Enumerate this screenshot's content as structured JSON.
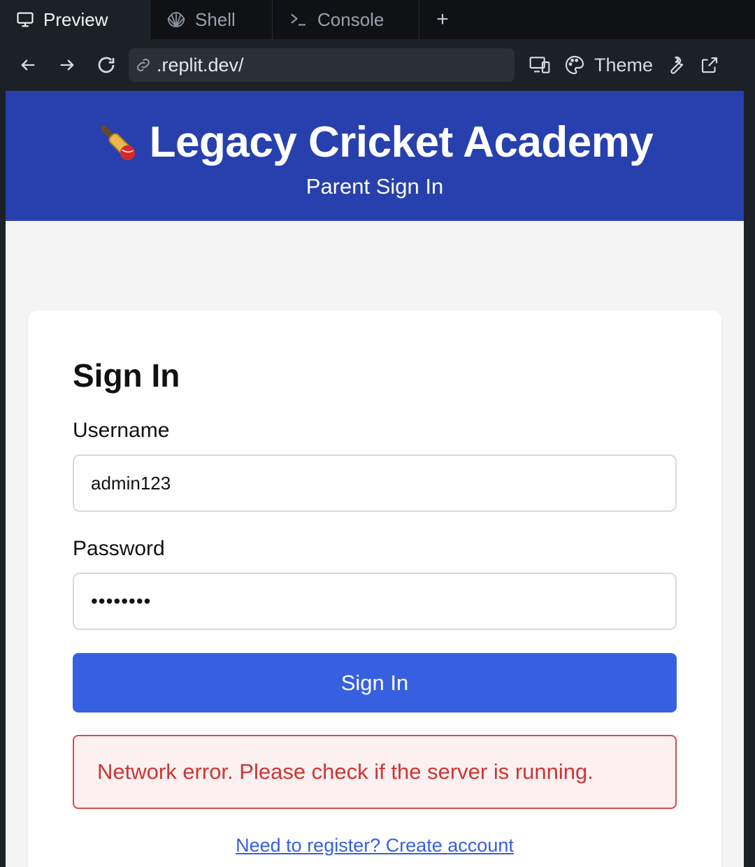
{
  "tabs": [
    {
      "label": "Preview",
      "icon": "monitor-icon",
      "active": true
    },
    {
      "label": "Shell",
      "icon": "shell-icon",
      "active": false
    },
    {
      "label": "Console",
      "icon": "terminal-icon",
      "active": false
    }
  ],
  "new_tab_symbol": "+",
  "url": ".replit.dev/",
  "toolbar": {
    "theme_label": "Theme"
  },
  "app": {
    "title": "Legacy Cricket Academy",
    "subtitle": "Parent Sign In",
    "logo_icon": "cricket-bat-ball-icon"
  },
  "form": {
    "heading": "Sign In",
    "username_label": "Username",
    "username_value": "admin123",
    "password_label": "Password",
    "password_value": "••••••••",
    "submit_label": "Sign In",
    "error_message": "Network error. Please check if the server is running.",
    "register_link": "Need to register? Create account"
  },
  "colors": {
    "header_bg": "#2740ad",
    "primary": "#3660e0",
    "error_text": "#cf3535",
    "error_bg": "#fcf0f0"
  }
}
